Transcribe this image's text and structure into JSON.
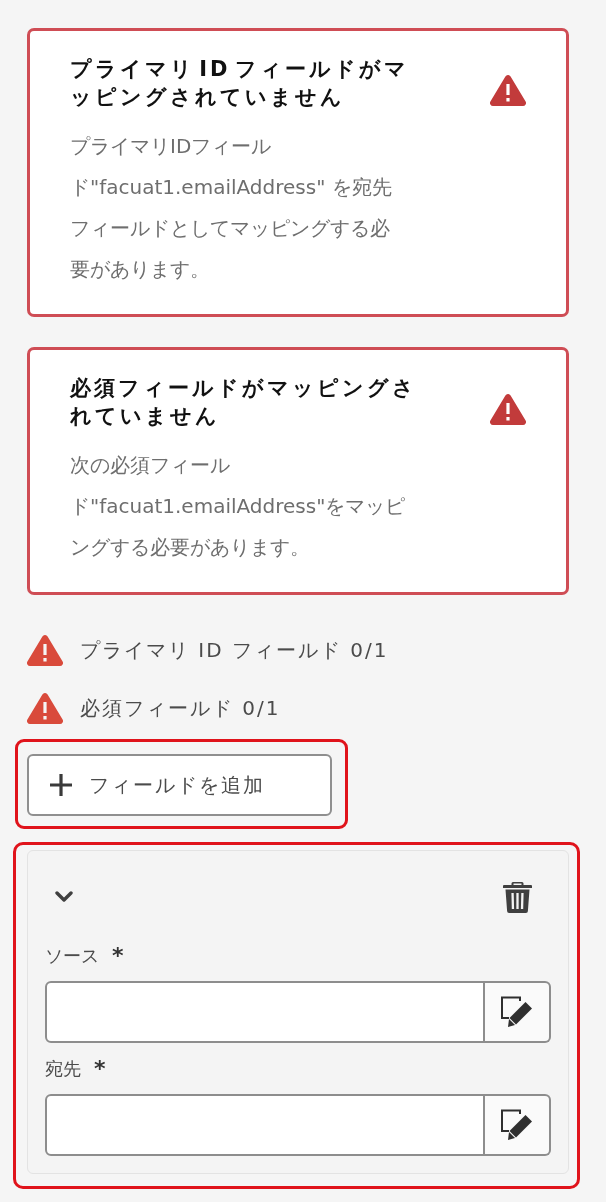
{
  "alerts": [
    {
      "title": "プライマリ ID フィールドがマッピングされていません",
      "message": "プライマリIDフィールド\"facuat1.emailAddress\" を宛先フィールドとしてマッピングする必要があります。"
    },
    {
      "title": "必須フィールドがマッピングされていません",
      "message": "次の必須フィールド\"facuat1.emailAddress\"をマッピングする必要があります。"
    }
  ],
  "requirements": [
    {
      "label": "プライマリ ID フィールド 0/1",
      "met": false
    },
    {
      "label": "必須フィールド 0/1",
      "met": false
    }
  ],
  "add_field_button": {
    "label": "フィールドを追加",
    "highlighted": true
  },
  "mapping": {
    "highlighted": true,
    "expanded": true,
    "fields": [
      {
        "label": "ソース",
        "required_mark": "*"
      },
      {
        "label": "宛先",
        "required_mark": "*"
      }
    ]
  }
}
